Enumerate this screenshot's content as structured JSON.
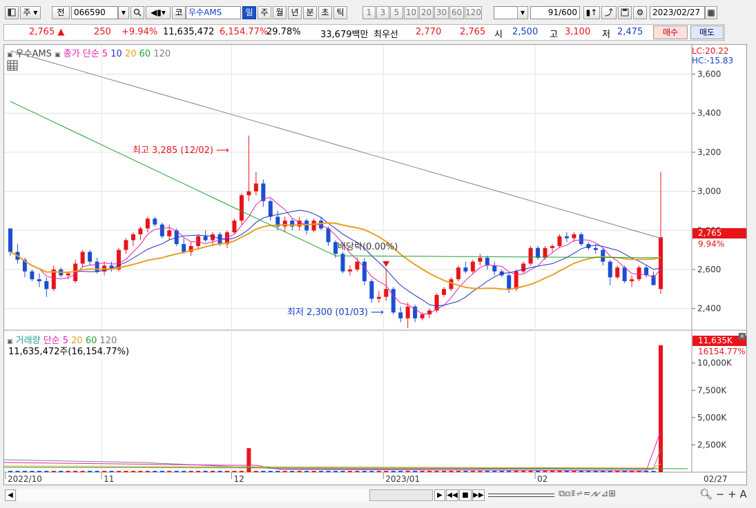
{
  "toolbar": {
    "period_label": "주",
    "prev_label": "전",
    "code": "066590",
    "market_label": "코",
    "name": "우수AMS",
    "periods": [
      "일",
      "주",
      "월",
      "년",
      "분",
      "초",
      "틱"
    ],
    "nums": [
      "1",
      "3",
      "5",
      "10",
      "20",
      "30",
      "60",
      "120"
    ],
    "count": "91",
    "count_total": "/600",
    "date": "2023/02/27"
  },
  "quote": {
    "price": "2,765",
    "change": "250",
    "change_pct": "+9.94%",
    "volume": "11,635,472",
    "vol_ratio": "6,154.77%",
    "turnover": "29.78%",
    "amount": "33,679백만",
    "bid_label": "최우선",
    "ask": "2,770",
    "bid": "2,765",
    "open_label": "시",
    "open": "2,500",
    "high_label": "고",
    "high": "3,100",
    "low_label": "저",
    "low": "2,475",
    "buy_label": "매수",
    "sell_label": "매도"
  },
  "price_panel": {
    "title": "우수AMS",
    "legend_label": "종가 단순",
    "lc": "LC:20.22",
    "hc": "HC:-15.83",
    "last_price": "2,765",
    "last_pct": "9.94%",
    "annot_high": "최고 3,285 (12/02)",
    "annot_low": "최저 2,300 (01/03)",
    "annot_div": "배당락(0.00%)"
  },
  "volume_panel": {
    "title": "거래량",
    "legend_label": "단순",
    "summary": "11,635,472주(16,154.77%)",
    "last_vol": "11,635K",
    "last_pct": "16154.77%"
  },
  "colors": {
    "up": "#e8141a",
    "down": "#1a4fd0",
    "ma5": "#e020b0",
    "ma10": "#2030c0",
    "ma20": "#e8a020",
    "ma60": "#20a030",
    "ma120": "#808080"
  },
  "chart_data": [
    {
      "type": "candlestick",
      "title": "우수AMS",
      "x_labels": [
        "2022/10",
        "11",
        "12",
        "2023/01",
        "02",
        "02/27"
      ],
      "y_ticks": [
        2400,
        2600,
        2800,
        3000,
        3200,
        3400,
        3600
      ],
      "ylim": [
        2300,
        3750
      ],
      "ma_periods": [
        5,
        10,
        20,
        60,
        120
      ],
      "candles": [
        [
          2810,
          2810,
          2670,
          2690
        ],
        [
          2690,
          2730,
          2630,
          2650
        ],
        [
          2650,
          2660,
          2560,
          2590
        ],
        [
          2590,
          2600,
          2540,
          2550
        ],
        [
          2550,
          2580,
          2510,
          2540
        ],
        [
          2540,
          2560,
          2460,
          2500
        ],
        [
          2500,
          2620,
          2490,
          2600
        ],
        [
          2600,
          2610,
          2560,
          2570
        ],
        [
          2570,
          2590,
          2550,
          2580
        ],
        [
          2540,
          2650,
          2530,
          2630
        ],
        [
          2630,
          2700,
          2610,
          2690
        ],
        [
          2690,
          2700,
          2620,
          2640
        ],
        [
          2640,
          2660,
          2580,
          2590
        ],
        [
          2590,
          2640,
          2570,
          2620
        ],
        [
          2620,
          2640,
          2590,
          2600
        ],
        [
          2600,
          2710,
          2590,
          2700
        ],
        [
          2700,
          2760,
          2680,
          2750
        ],
        [
          2750,
          2790,
          2720,
          2780
        ],
        [
          2780,
          2820,
          2750,
          2810
        ],
        [
          2810,
          2870,
          2790,
          2860
        ],
        [
          2860,
          2870,
          2820,
          2830
        ],
        [
          2830,
          2840,
          2760,
          2770
        ],
        [
          2770,
          2830,
          2750,
          2800
        ],
        [
          2800,
          2810,
          2720,
          2730
        ],
        [
          2730,
          2760,
          2680,
          2690
        ],
        [
          2690,
          2740,
          2670,
          2720
        ],
        [
          2720,
          2780,
          2700,
          2770
        ],
        [
          2770,
          2800,
          2740,
          2750
        ],
        [
          2750,
          2790,
          2720,
          2780
        ],
        [
          2780,
          2790,
          2720,
          2730
        ],
        [
          2730,
          2800,
          2710,
          2790
        ],
        [
          2790,
          2860,
          2780,
          2850
        ],
        [
          2850,
          2990,
          2830,
          2980
        ],
        [
          2980,
          3285,
          2950,
          3000
        ],
        [
          3000,
          3100,
          2980,
          3040
        ],
        [
          3040,
          3060,
          2920,
          2950
        ],
        [
          2950,
          2960,
          2850,
          2870
        ],
        [
          2870,
          2900,
          2800,
          2820
        ],
        [
          2820,
          2870,
          2790,
          2850
        ],
        [
          2850,
          2860,
          2800,
          2820
        ],
        [
          2820,
          2870,
          2800,
          2850
        ],
        [
          2850,
          2860,
          2780,
          2800
        ],
        [
          2800,
          2860,
          2790,
          2850
        ],
        [
          2850,
          2870,
          2800,
          2810
        ],
        [
          2810,
          2820,
          2720,
          2740
        ],
        [
          2740,
          2750,
          2660,
          2680
        ],
        [
          2680,
          2690,
          2580,
          2590
        ],
        [
          2590,
          2620,
          2570,
          2600
        ],
        [
          2600,
          2660,
          2590,
          2640
        ],
        [
          2640,
          2660,
          2520,
          2540
        ],
        [
          2540,
          2550,
          2430,
          2450
        ],
        [
          2450,
          2490,
          2430,
          2460
        ],
        [
          2460,
          2600,
          2440,
          2500
        ],
        [
          2500,
          2510,
          2370,
          2380
        ],
        [
          2380,
          2410,
          2330,
          2350
        ],
        [
          2350,
          2430,
          2300,
          2410
        ],
        [
          2410,
          2420,
          2330,
          2350
        ],
        [
          2350,
          2380,
          2340,
          2370
        ],
        [
          2370,
          2400,
          2350,
          2390
        ],
        [
          2390,
          2480,
          2380,
          2470
        ],
        [
          2470,
          2510,
          2460,
          2500
        ],
        [
          2500,
          2560,
          2490,
          2550
        ],
        [
          2550,
          2620,
          2540,
          2610
        ],
        [
          2610,
          2640,
          2580,
          2590
        ],
        [
          2590,
          2650,
          2580,
          2640
        ],
        [
          2640,
          2680,
          2620,
          2660
        ],
        [
          2660,
          2670,
          2600,
          2620
        ],
        [
          2620,
          2640,
          2570,
          2590
        ],
        [
          2590,
          2600,
          2560,
          2570
        ],
        [
          2570,
          2580,
          2480,
          2500
        ],
        [
          2500,
          2600,
          2490,
          2590
        ],
        [
          2590,
          2640,
          2580,
          2630
        ],
        [
          2630,
          2720,
          2620,
          2710
        ],
        [
          2710,
          2720,
          2650,
          2660
        ],
        [
          2660,
          2720,
          2650,
          2710
        ],
        [
          2710,
          2730,
          2690,
          2720
        ],
        [
          2720,
          2780,
          2710,
          2770
        ],
        [
          2770,
          2790,
          2740,
          2760
        ],
        [
          2760,
          2790,
          2740,
          2780
        ],
        [
          2780,
          2790,
          2720,
          2730
        ],
        [
          2730,
          2740,
          2700,
          2710
        ],
        [
          2710,
          2730,
          2680,
          2700
        ],
        [
          2700,
          2710,
          2620,
          2640
        ],
        [
          2640,
          2650,
          2520,
          2560
        ],
        [
          2560,
          2620,
          2550,
          2610
        ],
        [
          2610,
          2620,
          2530,
          2540
        ],
        [
          2540,
          2570,
          2510,
          2550
        ],
        [
          2550,
          2620,
          2540,
          2610
        ],
        [
          2610,
          2620,
          2560,
          2570
        ],
        [
          2570,
          2590,
          2520,
          2520
        ],
        [
          2500,
          3100,
          2475,
          2765
        ]
      ]
    },
    {
      "type": "bar",
      "title": "거래량",
      "y_ticks": [
        "2,500K",
        "5,000K",
        "7,500K",
        "10,000K"
      ],
      "ylim": [
        0,
        12000
      ],
      "ma_periods": [
        5,
        20,
        60,
        120
      ],
      "spike_index": 33,
      "spike_value": 2200,
      "last_value": 11635,
      "base_value": 120
    }
  ]
}
